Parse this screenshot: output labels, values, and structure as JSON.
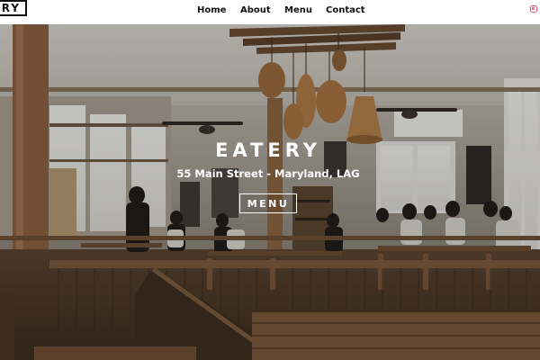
{
  "brand": {
    "logo_text": "ERY"
  },
  "nav": {
    "items": [
      {
        "label": "Home"
      },
      {
        "label": "About"
      },
      {
        "label": "Menu"
      },
      {
        "label": "Contact"
      }
    ],
    "social_icon": "instagram-icon"
  },
  "hero": {
    "title": "EATERY",
    "address": "55 Main Street - Maryland, LAG",
    "button_label": "MENU"
  },
  "colors": {
    "nav_background": "#ffffff",
    "nav_text": "#111111",
    "hero_text": "#ffffff",
    "instagram_accent": "#e4405f"
  }
}
